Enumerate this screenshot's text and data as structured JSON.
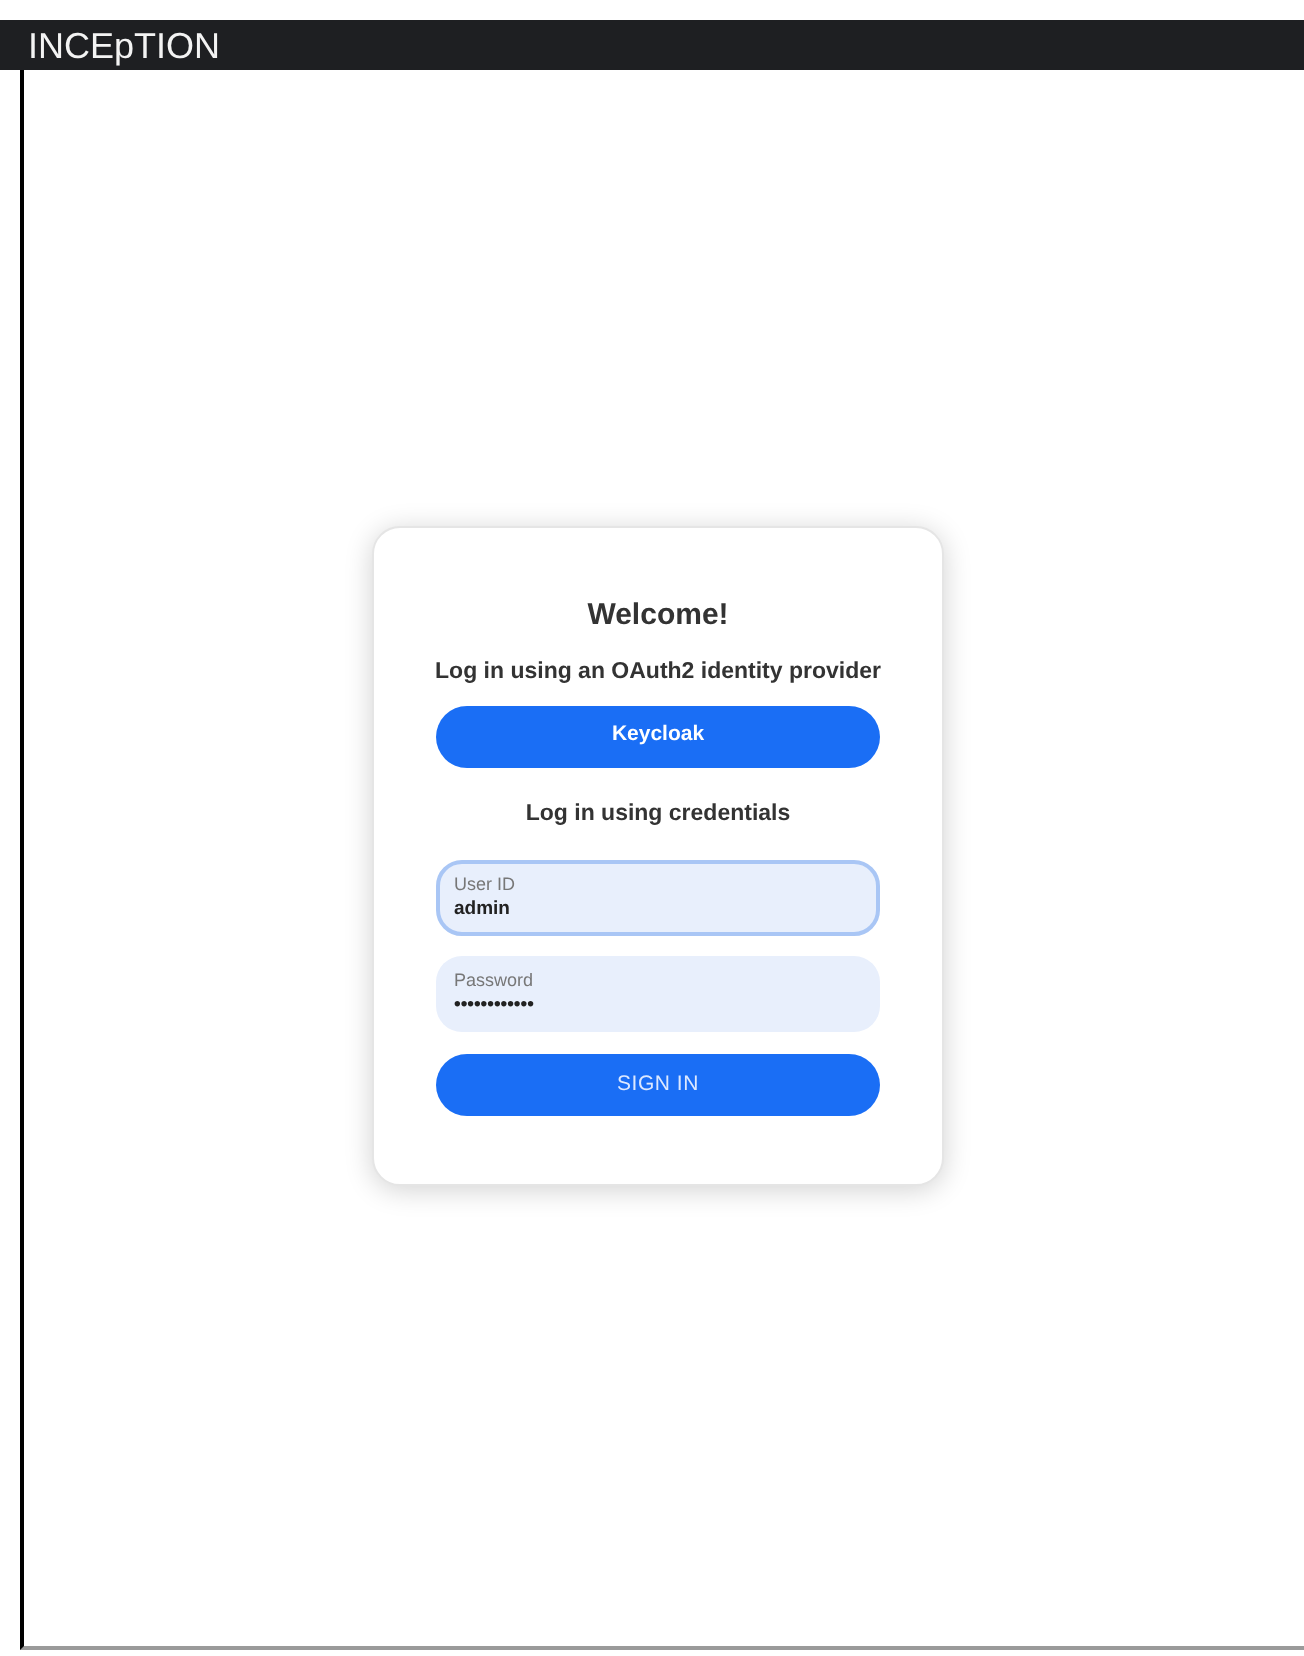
{
  "window": {
    "title": "INCEpTION"
  },
  "login": {
    "heading": "Welcome!",
    "oauth_label": "Log in using an OAuth2 identity provider",
    "oauth_button": "Keycloak",
    "credentials_label": "Log in using credentials",
    "fields": [
      {
        "label": "User ID",
        "value": "admin",
        "focused": true
      },
      {
        "label": "Password",
        "value": "••••••••••••",
        "focused": false
      }
    ],
    "submit_button": "SIGN IN"
  }
}
